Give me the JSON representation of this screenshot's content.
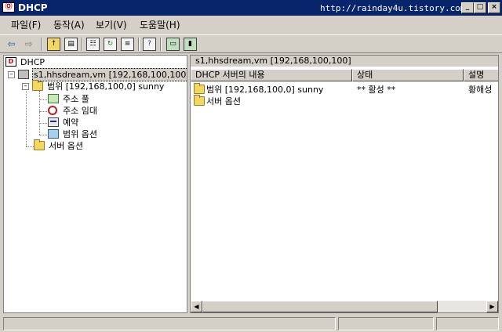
{
  "window": {
    "title": "DHCP",
    "app_icon_text": "Ⓞ",
    "watermark": "http://rainday4u.tistory.com",
    "controls": {
      "minimize": "_",
      "maximize": "□",
      "close": "×"
    }
  },
  "menu": {
    "file": "파일(F)",
    "action": "동작(A)",
    "view": "보기(V)",
    "help": "도움말(H)"
  },
  "toolbar": {
    "back_icon": "⇦",
    "forward_icon": "⇨",
    "icons": [
      "up-folder-icon",
      "show-hide-tree-icon",
      "properties-icon",
      "refresh-icon",
      "export-list-icon",
      "help-icon",
      "monitor-icon",
      "server-monitor-icon"
    ]
  },
  "tree": {
    "root": "DHCP",
    "server": "s1,hhsdream,vm [192,168,100,100]",
    "scope": "범위 [192,168,100,0] sunny",
    "address_pool": "주소 풀",
    "address_leases": "주소 임대",
    "reservations": "예약",
    "scope_options": "범위 옵션",
    "server_options": "서버 옵션"
  },
  "details": {
    "title": "s1,hhsdream,vm [192,168,100,100]",
    "columns": [
      "DHCP 서버의 내용",
      "상태",
      "설명"
    ],
    "rows": [
      {
        "name": "범위 [192,168,100,0] sunny",
        "status": "** 활성 **",
        "description": "황해성"
      },
      {
        "name": "서버 옵션",
        "status": "",
        "description": ""
      }
    ]
  },
  "colors": {
    "titlebar": "#08246b",
    "face": "#d4d0c8",
    "folder": "#f2d863"
  }
}
